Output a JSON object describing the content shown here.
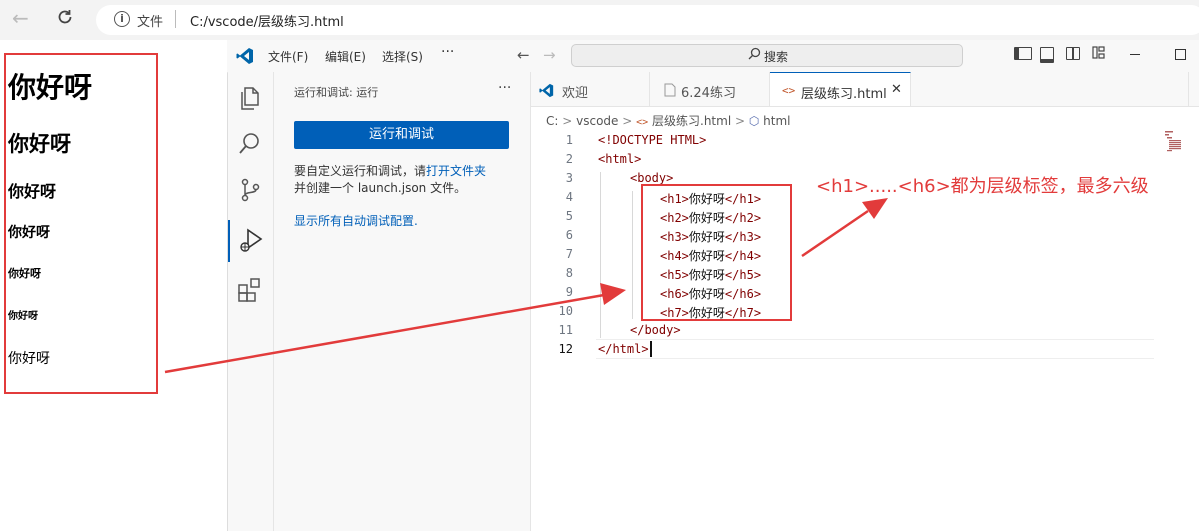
{
  "browser": {
    "file_label": "文件",
    "url": "C:/vscode/层级练习.html"
  },
  "rendered_page": {
    "headings": [
      "你好呀",
      "你好呀",
      "你好呀",
      "你好呀",
      "你好呀",
      "你好呀",
      "你好呀"
    ]
  },
  "vscode": {
    "menu": {
      "file": "文件(F)",
      "edit": "编辑(E)",
      "select": "选择(S)",
      "more": "···"
    },
    "search_label": "搜索",
    "sidebar": {
      "title": "运行和调试: 运行",
      "more": "···",
      "run_button": "运行和调试",
      "desc_part1": "要自定义运行和调试，请",
      "desc_link": "打开文件夹",
      "desc_part2": "并创建一个 launch.json 文件。",
      "show_all": "显示所有自动调试配置."
    },
    "tabs": [
      {
        "label": "欢迎",
        "icon": "vscode-logo-icon"
      },
      {
        "label": "6.24练习",
        "icon": "file-icon"
      },
      {
        "label": "层级练习.html",
        "icon": "html-code-icon",
        "active": true
      }
    ],
    "breadcrumb": {
      "root": "C:",
      "folder": "vscode",
      "file": "层级练习.html",
      "node": "html"
    },
    "code_lines": [
      {
        "n": "1",
        "text": "<!DOCTYPE HTML>"
      },
      {
        "n": "2",
        "text": "<html>"
      },
      {
        "n": "3",
        "text": "<body>"
      },
      {
        "n": "4",
        "open": "<h1>",
        "body": "你好呀",
        "close": "</h1>"
      },
      {
        "n": "5",
        "open": "<h2>",
        "body": "你好呀",
        "close": "</h2>"
      },
      {
        "n": "6",
        "open": "<h3>",
        "body": "你好呀",
        "close": "</h3>"
      },
      {
        "n": "7",
        "open": "<h4>",
        "body": "你好呀",
        "close": "</h4>"
      },
      {
        "n": "8",
        "open": "<h5>",
        "body": "你好呀",
        "close": "</h5>"
      },
      {
        "n": "9",
        "open": "<h6>",
        "body": "你好呀",
        "close": "</h6>"
      },
      {
        "n": "10",
        "open": "<h7>",
        "body": "你好呀",
        "close": "</h7>"
      },
      {
        "n": "11",
        "text": "</body>"
      },
      {
        "n": "12",
        "text": "</html>"
      }
    ]
  },
  "annotation": {
    "text": "<h1>.....<h6>都为层级标签，最多六级",
    "color": "#e23b3b"
  },
  "colors": {
    "accent": "#005fb8",
    "annotation_red": "#e23b3b",
    "tag_color": "#800000"
  }
}
